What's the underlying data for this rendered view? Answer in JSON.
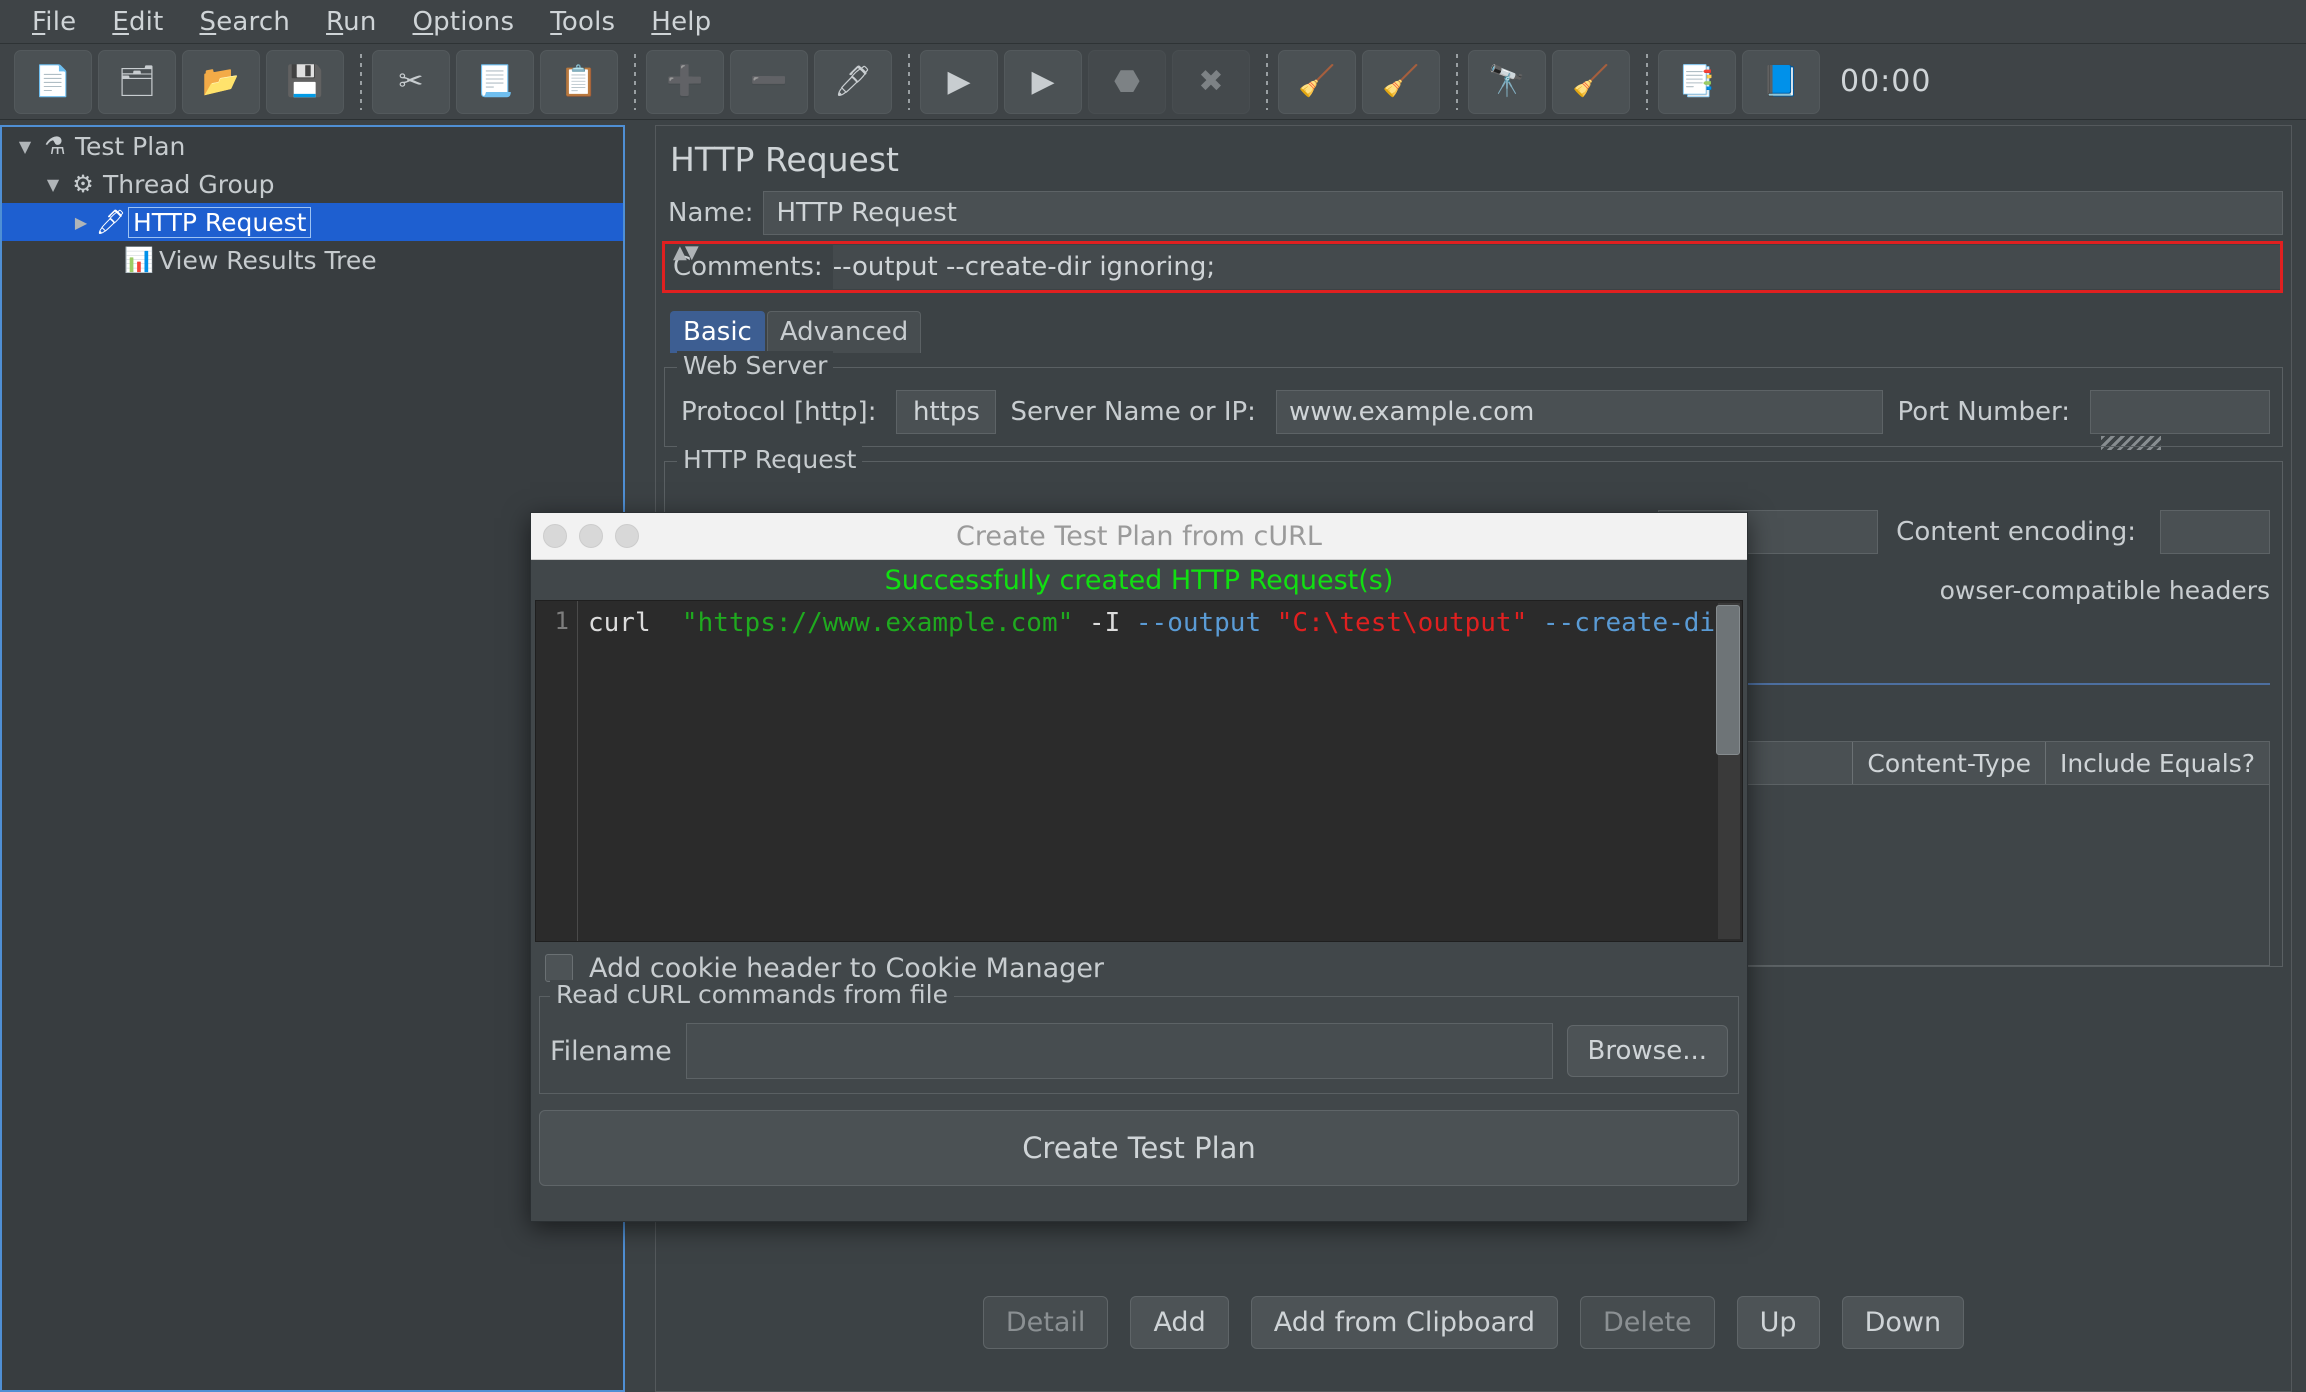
{
  "menu": {
    "items": [
      {
        "pre": "",
        "mn": "F",
        "post": "ile"
      },
      {
        "pre": "",
        "mn": "E",
        "post": "dit"
      },
      {
        "pre": "",
        "mn": "S",
        "post": "earch"
      },
      {
        "pre": "",
        "mn": "R",
        "post": "un"
      },
      {
        "pre": "",
        "mn": "O",
        "post": "ptions"
      },
      {
        "pre": "",
        "mn": "T",
        "post": "ools"
      },
      {
        "pre": "",
        "mn": "H",
        "post": "elp"
      }
    ]
  },
  "toolbar": {
    "buttons": [
      {
        "name": "new-button",
        "icon": "📄",
        "disabled": false
      },
      {
        "name": "templates-button",
        "icon": "🗂",
        "disabled": false
      },
      {
        "name": "open-button",
        "icon": "📂",
        "disabled": false
      },
      {
        "name": "save-button",
        "icon": "💾",
        "disabled": false
      },
      {
        "sep": true
      },
      {
        "name": "cut-button",
        "icon": "✂",
        "disabled": false
      },
      {
        "name": "copy-button",
        "icon": "📃",
        "disabled": false
      },
      {
        "name": "paste-button",
        "icon": "📋",
        "disabled": false
      },
      {
        "sep": true
      },
      {
        "name": "expand-all-button",
        "icon": "➕",
        "disabled": false
      },
      {
        "name": "collapse-all-button",
        "icon": "➖",
        "disabled": false
      },
      {
        "name": "toggle-button",
        "icon": "🖊",
        "disabled": false
      },
      {
        "sep": true
      },
      {
        "name": "start-button",
        "icon": "▶",
        "disabled": false
      },
      {
        "name": "start-no-pause-button",
        "icon": "▶",
        "disabled": false
      },
      {
        "name": "stop-button",
        "icon": "⬣",
        "disabled": true
      },
      {
        "name": "shutdown-button",
        "icon": "✖",
        "disabled": true
      },
      {
        "sep": true
      },
      {
        "name": "clear-button",
        "icon": "🧹",
        "disabled": false
      },
      {
        "name": "clear-all-button",
        "icon": "🧹",
        "disabled": false
      },
      {
        "sep": true
      },
      {
        "name": "search-button",
        "icon": "🔭",
        "disabled": false
      },
      {
        "name": "reset-search-button",
        "icon": "🧹",
        "disabled": false
      },
      {
        "sep": true
      },
      {
        "name": "log-viewer-button",
        "icon": "📑",
        "disabled": false
      },
      {
        "name": "help-button",
        "icon": "📘",
        "disabled": false
      }
    ],
    "timer": "00:00"
  },
  "tree": {
    "nodes": [
      {
        "label": "Test Plan",
        "icon": "⚗",
        "toggle": "▼",
        "indent": 0,
        "selected": false
      },
      {
        "label": "Thread Group",
        "icon": "⚙",
        "toggle": "▼",
        "indent": 1,
        "selected": false
      },
      {
        "label": "HTTP Request",
        "icon": "🖊",
        "toggle": "▶",
        "indent": 2,
        "selected": true
      },
      {
        "label": "View Results Tree",
        "icon": "📊",
        "toggle": "",
        "indent": 3,
        "selected": false
      }
    ]
  },
  "panel": {
    "title": "HTTP Request",
    "name_label": "Name:",
    "name_value": "HTTP Request",
    "comments_label": "Comments:",
    "comments_value": "--output --create-dir ignoring;",
    "tabs": [
      {
        "label": "Basic",
        "active": true
      },
      {
        "label": "Advanced",
        "active": false
      }
    ],
    "web_server": {
      "group_label": "Web Server",
      "protocol_label": "Protocol [http]:",
      "protocol_value": "https",
      "server_label": "Server Name or IP:",
      "server_value": "www.example.com",
      "port_label": "Port Number:",
      "port_value": ""
    },
    "http_request": {
      "group_label": "HTTP Request",
      "content_encoding_label": "Content encoding:",
      "content_encoding_value": "",
      "browser_headers_text": "owser-compatible headers"
    },
    "params_table": {
      "columns": [
        "Content-Type",
        "Include Equals?"
      ]
    },
    "bottom_buttons": [
      {
        "label": "Detail",
        "disabled": true
      },
      {
        "label": "Add",
        "disabled": false
      },
      {
        "label": "Add from Clipboard",
        "disabled": false
      },
      {
        "label": "Delete",
        "disabled": true
      },
      {
        "label": "Up",
        "disabled": false
      },
      {
        "label": "Down",
        "disabled": false
      }
    ]
  },
  "dialog": {
    "title": "Create Test Plan from cURL",
    "status": "Successfully created HTTP Request(s)",
    "line_number": "1",
    "code_tokens": [
      {
        "text": "curl  ",
        "cls": "c-cmd"
      },
      {
        "text": "\"https://www.example.com\"",
        "cls": "c-url"
      },
      {
        "text": " -I ",
        "cls": "c-flag"
      },
      {
        "text": "--output",
        "cls": "c-opt"
      },
      {
        "text": " ",
        "cls": "c-cmd"
      },
      {
        "text": "\"C:\\test\\output\"",
        "cls": "c-str"
      },
      {
        "text": " ",
        "cls": "c-cmd"
      },
      {
        "text": "--create-dir",
        "cls": "c-opt"
      }
    ],
    "cookie_checkbox_label": "Add cookie header to Cookie Manager",
    "cookie_checkbox_checked": false,
    "file_group_label": "Read cURL commands from file",
    "filename_label": "Filename",
    "filename_value": "",
    "browse_label": "Browse...",
    "create_label": "Create Test Plan"
  },
  "colors": {
    "accent": "#1e5fd0",
    "success": "#11e011",
    "highlight": "#e02020"
  }
}
